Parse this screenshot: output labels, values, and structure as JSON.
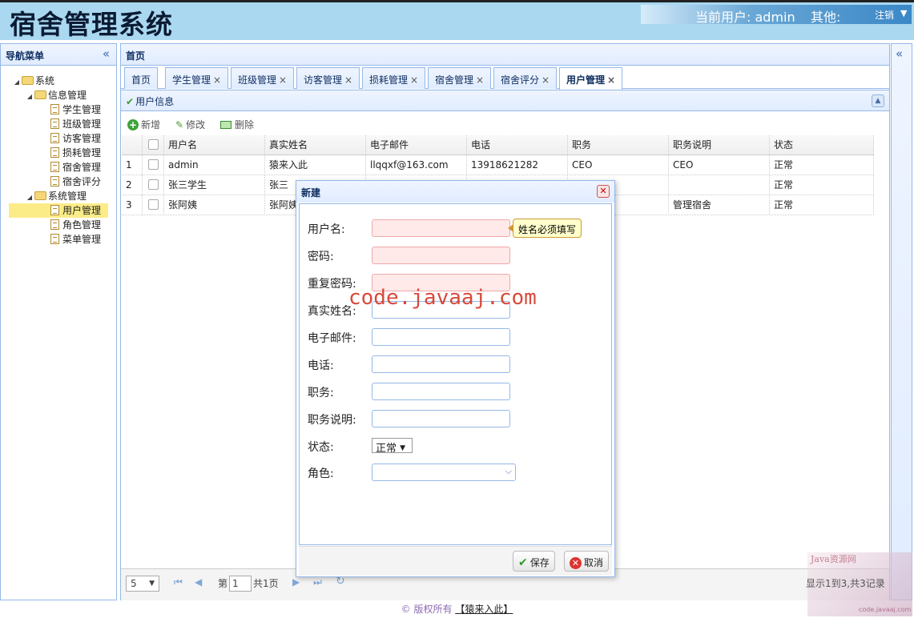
{
  "header": {
    "title": "宿舍管理系统",
    "current_user_label": "当前用户:",
    "current_user": "admin",
    "other_label": "其他:",
    "logout_label": "注销"
  },
  "sidebar": {
    "title": "导航菜单",
    "collapse_icon": "double-chevron-left-icon",
    "tree": {
      "root": "系统",
      "groups": [
        {
          "label": "信息管理",
          "items": [
            "学生管理",
            "班级管理",
            "访客管理",
            "损耗管理",
            "宿舍管理",
            "宿舍评分"
          ]
        },
        {
          "label": "系统管理",
          "items": [
            "用户管理",
            "角色管理",
            "菜单管理"
          ],
          "selected": "用户管理"
        }
      ]
    }
  },
  "main": {
    "title": "首页",
    "tabs": [
      {
        "label": "首页",
        "closable": false
      },
      {
        "label": "学生管理",
        "closable": true
      },
      {
        "label": "班级管理",
        "closable": true
      },
      {
        "label": "访客管理",
        "closable": true
      },
      {
        "label": "损耗管理",
        "closable": true
      },
      {
        "label": "宿舍管理",
        "closable": true
      },
      {
        "label": "宿舍评分",
        "closable": true
      },
      {
        "label": "用户管理",
        "closable": true,
        "active": true
      }
    ],
    "close_mark": "×",
    "panel_title": "用户信息",
    "toolbar": {
      "add": "新增",
      "edit": "修改",
      "delete": "删除"
    },
    "grid": {
      "columns": [
        "用户名",
        "真实姓名",
        "电子邮件",
        "电话",
        "职务",
        "职务说明",
        "状态"
      ],
      "rows": [
        {
          "num": "1",
          "cells": [
            "admin",
            "猿来入此",
            "llqqxf@163.com",
            "13918621282",
            "CEO",
            "CEO",
            "正常"
          ]
        },
        {
          "num": "2",
          "cells": [
            "张三学生",
            "张三",
            "",
            "",
            "",
            "",
            "正常"
          ]
        },
        {
          "num": "3",
          "cells": [
            "张阿姨",
            "张阿姨",
            "",
            "",
            "",
            "管理宿舍",
            "正常"
          ]
        }
      ]
    },
    "pager": {
      "page_size": "5",
      "page_prefix": "第",
      "page_value": "1",
      "page_suffix": "共1页",
      "summary": "显示1到3,共3记录"
    }
  },
  "dialog": {
    "title": "新建",
    "fields": [
      {
        "label": "用户名:",
        "value": "",
        "invalid": true
      },
      {
        "label": "密码:",
        "value": "",
        "invalid": true
      },
      {
        "label": "重复密码:",
        "value": "",
        "invalid": true
      },
      {
        "label": "真实姓名:",
        "value": ""
      },
      {
        "label": "电子邮件:",
        "value": ""
      },
      {
        "label": "电话:",
        "value": ""
      },
      {
        "label": "职务:",
        "value": ""
      },
      {
        "label": "职务说明:",
        "value": ""
      }
    ],
    "status_label": "状态:",
    "status_value": "正常",
    "role_label": "角色:",
    "role_value": "",
    "tooltip": "姓名必须填写",
    "save": "保存",
    "cancel": "取消"
  },
  "watermark": "code.javaaj.com",
  "corner_watermark": {
    "title": "Java资源网",
    "site": "code.javaaj.com"
  },
  "footer": {
    "copyright": "© 版权所有",
    "link": "【猿来入此】"
  },
  "colors": {
    "header_bg": "#a9d8f0",
    "panel_border": "#95b8e7",
    "selected_node": "#fbec88",
    "watermark": "#d53b2b",
    "footer_text": "#8c6bb1"
  }
}
